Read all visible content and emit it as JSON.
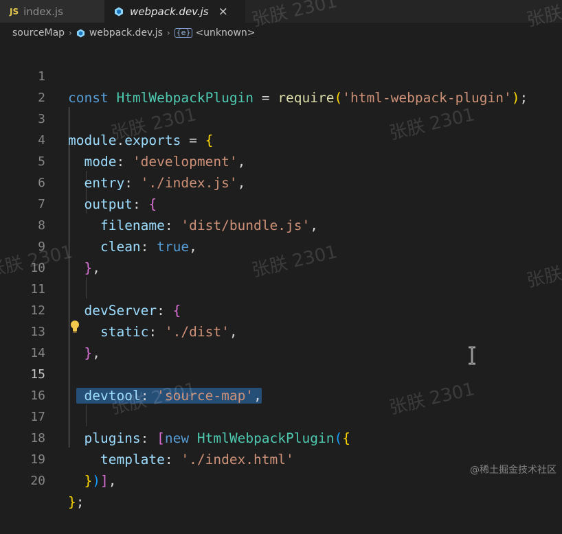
{
  "tabs": [
    {
      "badge": "JS",
      "label": "index.js",
      "active": false
    },
    {
      "label": "webpack.dev.js",
      "active": true,
      "close": "×"
    }
  ],
  "breadcrumb": {
    "folder": "sourceMap",
    "file": "webpack.dev.js",
    "symbol_icon": "{e}",
    "symbol": "<unknown>",
    "separator": "›"
  },
  "editor": {
    "current_line": 15,
    "line_numbers": [
      "1",
      "2",
      "3",
      "4",
      "5",
      "6",
      "7",
      "8",
      "9",
      "10",
      "11",
      "12",
      "13",
      "14",
      "15",
      "16",
      "17",
      "18",
      "19",
      "20"
    ],
    "lines": {
      "l1": {
        "kw": "const",
        "cls": "HtmlWebpackPlugin",
        "eq": " = ",
        "fn": "require",
        "open": "(",
        "str": "'html-webpack-plugin'",
        "close": ")",
        "end": ";"
      },
      "l3": {
        "obj": "module",
        "dot": ".",
        "prop": "exports",
        "eq": " = ",
        "brace": "{"
      },
      "l4": {
        "prop": "mode",
        "colon": ": ",
        "str": "'development'",
        "end": ","
      },
      "l5": {
        "prop": "entry",
        "colon": ": ",
        "str": "'./index.js'",
        "end": ","
      },
      "l6": {
        "prop": "output",
        "colon": ": ",
        "brace": "{"
      },
      "l7": {
        "prop": "filename",
        "colon": ": ",
        "str": "'dist/bundle.js'",
        "end": ","
      },
      "l8": {
        "prop": "clean",
        "colon": ": ",
        "kw": "true",
        "end": ","
      },
      "l9": {
        "brace": "}",
        "end": ","
      },
      "l11": {
        "prop": "devServer",
        "colon": ": ",
        "brace": "{"
      },
      "l12": {
        "prop": "static",
        "colon": ": ",
        "str": "'./dist'",
        "end": ","
      },
      "l13": {
        "brace": "}",
        "end": ","
      },
      "l15": {
        "prop": "devtool",
        "colon": ": ",
        "str": "'source-map'",
        "end": ","
      },
      "l17": {
        "prop": "plugins",
        "colon": ": ",
        "bracket": "[",
        "kw": "new",
        "cls": "HtmlWebpackPlugin",
        "paren": "(",
        "brace": "{"
      },
      "l18": {
        "prop": "template",
        "colon": ": ",
        "str": "'./index.html'"
      },
      "l19": {
        "brace": "}",
        "paren": ")",
        "bracket": "]",
        "end": ","
      },
      "l20": {
        "brace": "}",
        "end": ";"
      }
    }
  },
  "watermarks": {
    "text": "张朕 2301",
    "corner": "@稀土掘金技术社区"
  },
  "icons": {
    "tab_js": "js-file-icon",
    "tab_webpack": "webpack-icon",
    "lightbulb": "lightbulb-icon",
    "cursor": "text-cursor-icon"
  },
  "colors": {
    "keyword": "#569cd6",
    "class": "#4ec9b0",
    "function": "#dcdcaa",
    "string": "#ce9178",
    "property": "#9cdcfe",
    "bracket1": "#ffd700",
    "bracket2": "#da70d6",
    "selection": "#264f78"
  }
}
